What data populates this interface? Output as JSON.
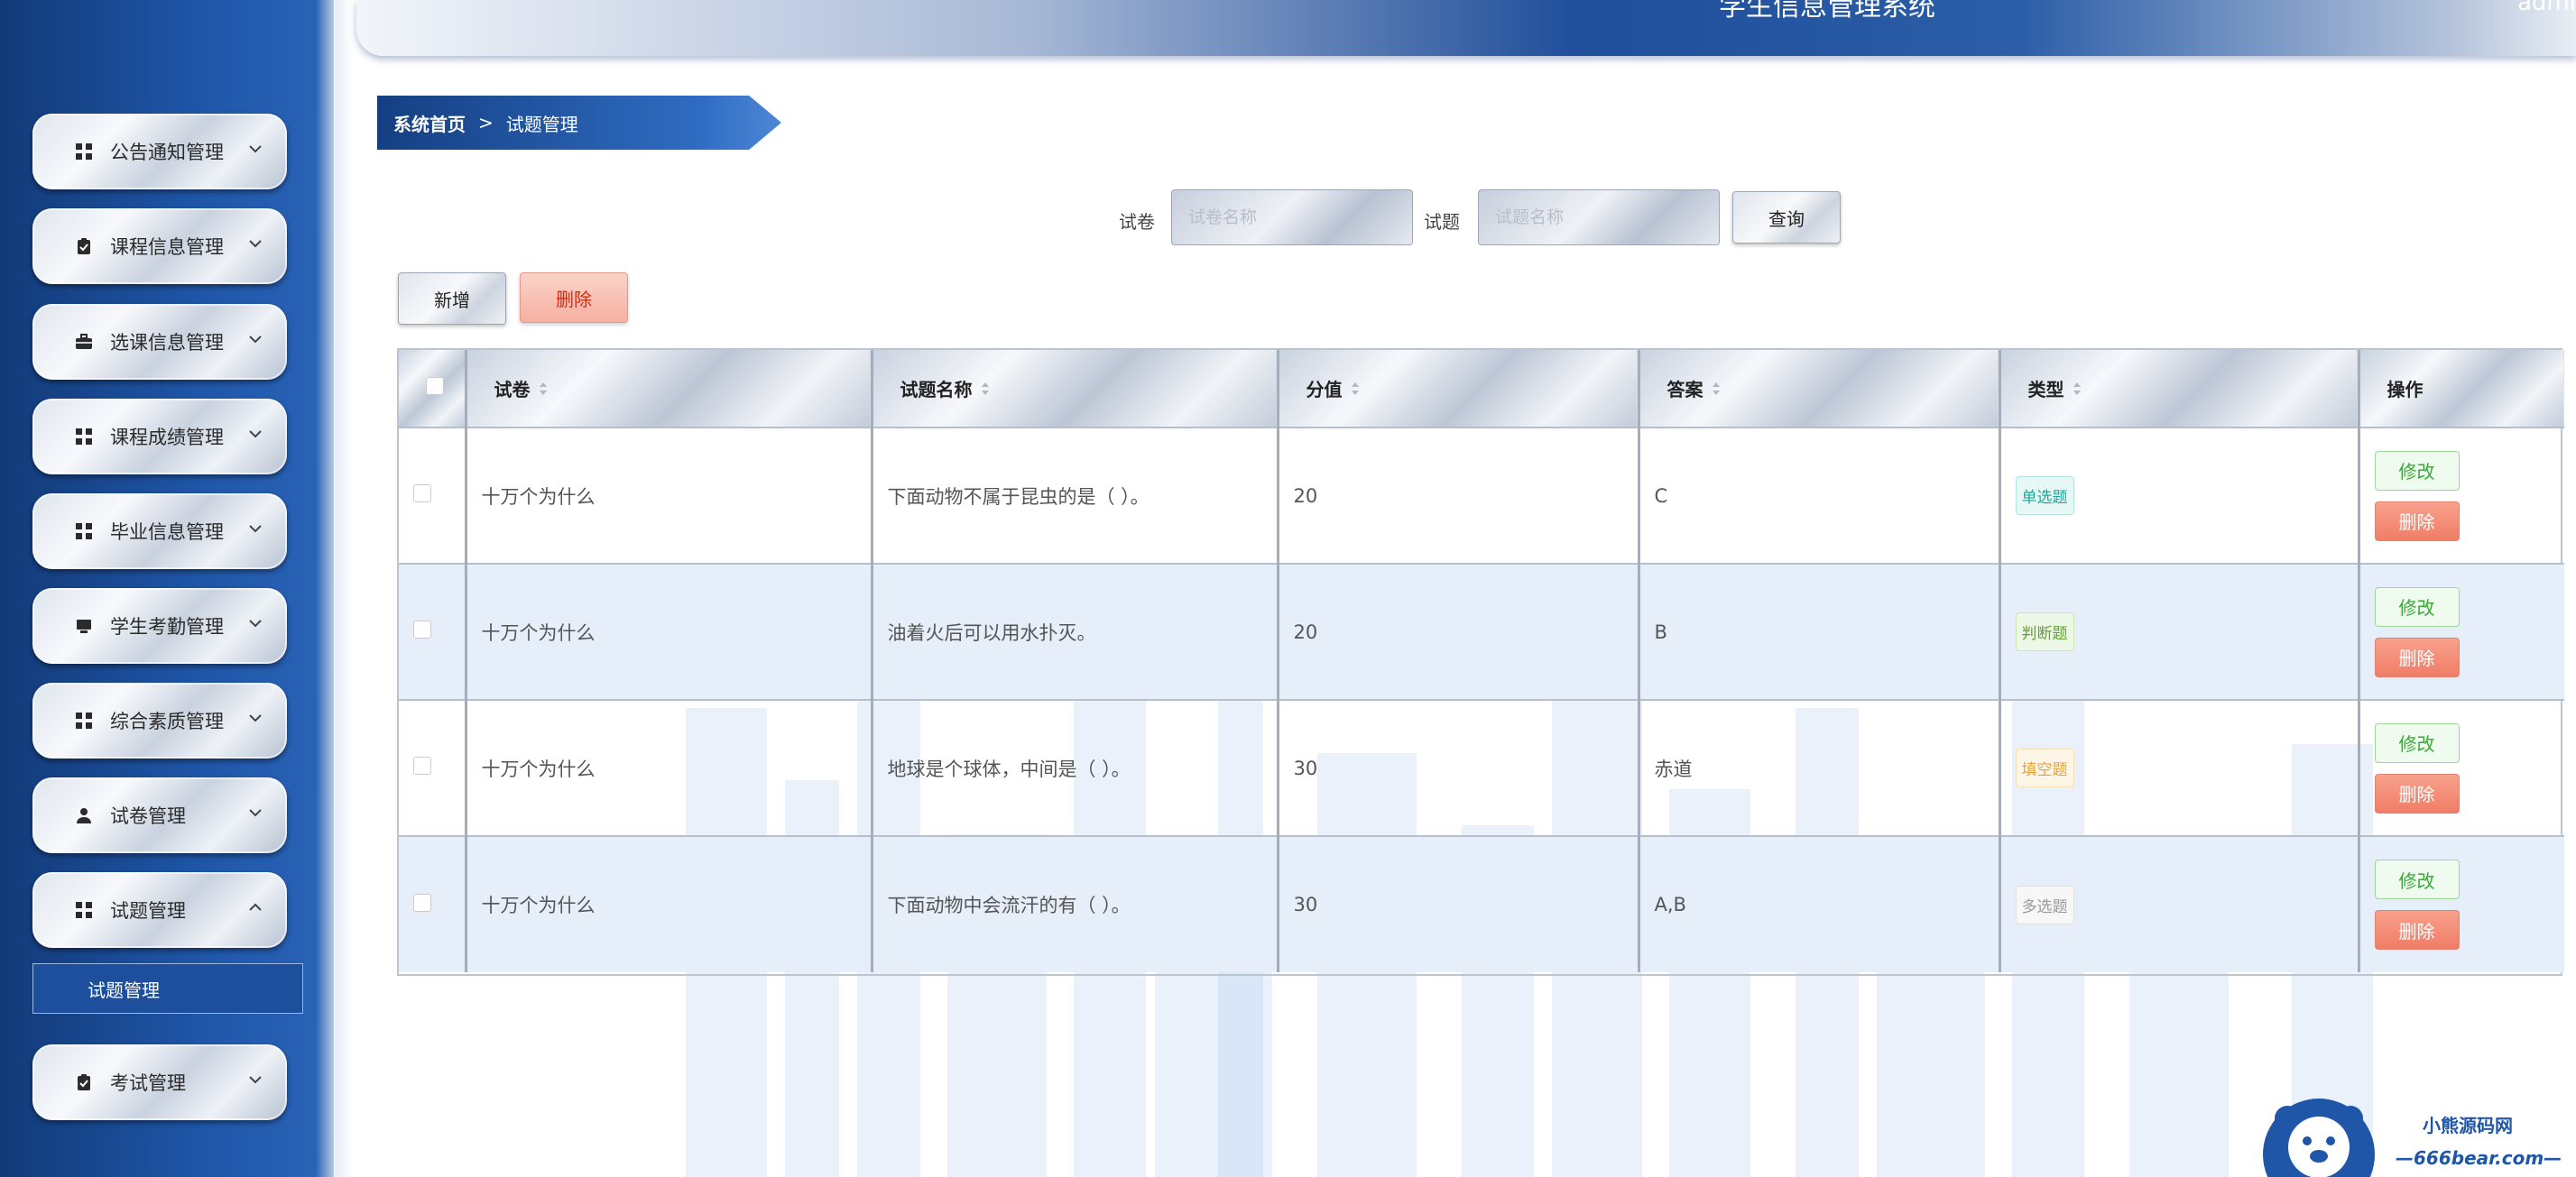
{
  "header": {
    "title": "学生信息管理系统",
    "user": "admin 退出登录"
  },
  "sidebar": {
    "items": [
      {
        "label": "公告通知管理",
        "icon": "grid-icon",
        "expanded": false
      },
      {
        "label": "课程信息管理",
        "icon": "clipboard-icon",
        "expanded": false
      },
      {
        "label": "选课信息管理",
        "icon": "briefcase-icon",
        "expanded": false
      },
      {
        "label": "课程成绩管理",
        "icon": "grid-icon",
        "expanded": false
      },
      {
        "label": "毕业信息管理",
        "icon": "grid-icon",
        "expanded": false
      },
      {
        "label": "学生考勤管理",
        "icon": "monitor-icon",
        "expanded": false
      },
      {
        "label": "综合素质管理",
        "icon": "grid-icon",
        "expanded": false
      },
      {
        "label": "试卷管理",
        "icon": "user-icon",
        "expanded": false
      },
      {
        "label": "试题管理",
        "icon": "grid-icon",
        "expanded": true
      },
      {
        "label": "考试管理",
        "icon": "clipboard-icon",
        "expanded": false
      }
    ],
    "submenu": {
      "label": "试题管理"
    }
  },
  "breadcrumb": {
    "home": "系统首页",
    "separator": ">",
    "current": "试题管理"
  },
  "search": {
    "paper_label": "试卷",
    "paper_placeholder": "试卷名称",
    "question_label": "试题",
    "question_placeholder": "试题名称",
    "query_button": "查询"
  },
  "actions": {
    "add": "新增",
    "delete": "删除"
  },
  "table": {
    "columns": [
      "试卷",
      "试题名称",
      "分值",
      "答案",
      "类型",
      "操作"
    ],
    "rows": [
      {
        "paper": "十万个为什么",
        "name": "下面动物不属于昆虫的是（ ）。",
        "score": "20",
        "answer": "C",
        "type": "单选题",
        "type_class": "tag-single"
      },
      {
        "paper": "十万个为什么",
        "name": "油着火后可以用水扑灭。",
        "score": "20",
        "answer": "B",
        "type": "判断题",
        "type_class": "tag-judge"
      },
      {
        "paper": "十万个为什么",
        "name": "地球是个球体，中间是（ ）。",
        "score": "30",
        "answer": "赤道",
        "type": "填空题",
        "type_class": "tag-fill"
      },
      {
        "paper": "十万个为什么",
        "name": "下面动物中会流汗的有（ ）。",
        "score": "30",
        "answer": "A,B",
        "type": "多选题",
        "type_class": "tag-multi"
      }
    ],
    "edit_label": "修改",
    "delete_label": "删除"
  },
  "watermark": {
    "line1": "小熊源码网",
    "line2": "—666bear.com—"
  },
  "colors": {
    "primary": "#1f56a8",
    "danger": "#f07d66",
    "success": "#3aa93a"
  }
}
